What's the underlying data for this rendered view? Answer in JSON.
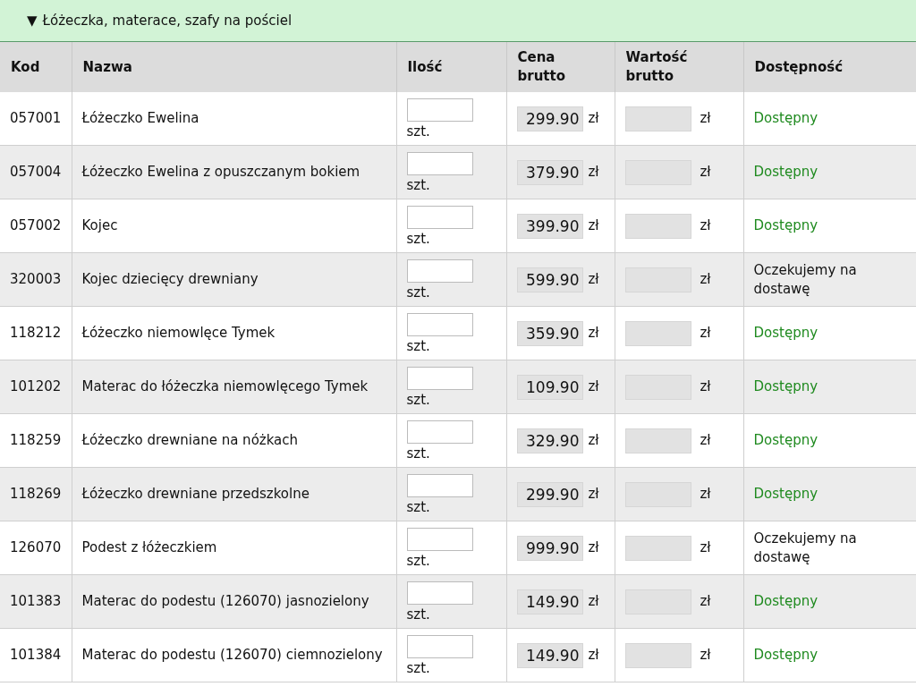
{
  "section": {
    "toggle": "▼",
    "title": "Łóżeczka, materace, szafy na pościel"
  },
  "table": {
    "columns": [
      "Kod",
      "Nazwa",
      "Ilość",
      "Cena brutto",
      "Wartość brutto",
      "Dostępność"
    ],
    "rows": [
      {
        "code": "057001",
        "name": "Łóżeczko Ewelina",
        "unit": "szt.",
        "price": "299.90",
        "currency": "zł",
        "value_currency": "zł",
        "availability": {
          "kind": "available",
          "text": "Dostępny"
        }
      },
      {
        "code": "057004",
        "name": "Łóżeczko Ewelina z opuszczanym bokiem",
        "unit": "szt.",
        "price": "379.90",
        "currency": "zł",
        "value_currency": "zł",
        "availability": {
          "kind": "available",
          "text": "Dostępny"
        }
      },
      {
        "code": "057002",
        "name": "Kojec",
        "unit": "szt.",
        "price": "399.90",
        "currency": "zł",
        "value_currency": "zł",
        "availability": {
          "kind": "available",
          "text": "Dostępny"
        }
      },
      {
        "code": "320003",
        "name": "Kojec dziecięcy drewniany",
        "unit": "szt.",
        "price": "599.90",
        "currency": "zł",
        "value_currency": "zł",
        "availability": {
          "kind": "awaiting",
          "text": "Oczekujemy na dostawę"
        }
      },
      {
        "code": "118212",
        "name": "Łóżeczko niemowlęce Tymek",
        "unit": "szt.",
        "price": "359.90",
        "currency": "zł",
        "value_currency": "zł",
        "availability": {
          "kind": "available",
          "text": "Dostępny"
        }
      },
      {
        "code": "101202",
        "name": "Materac do łóżeczka niemowlęcego Tymek",
        "unit": "szt.",
        "price": "109.90",
        "currency": "zł",
        "value_currency": "zł",
        "availability": {
          "kind": "available",
          "text": "Dostępny"
        }
      },
      {
        "code": "118259",
        "name": "Łóżeczko drewniane na nóżkach",
        "unit": "szt.",
        "price": "329.90",
        "currency": "zł",
        "value_currency": "zł",
        "availability": {
          "kind": "available",
          "text": "Dostępny"
        }
      },
      {
        "code": "118269",
        "name": "Łóżeczko drewniane przedszkolne",
        "unit": "szt.",
        "price": "299.90",
        "currency": "zł",
        "value_currency": "zł",
        "availability": {
          "kind": "available",
          "text": "Dostępny"
        }
      },
      {
        "code": "126070",
        "name": "Podest z łóżeczkiem",
        "unit": "szt.",
        "price": "999.90",
        "currency": "zł",
        "value_currency": "zł",
        "availability": {
          "kind": "awaiting",
          "text": "Oczekujemy na dostawę"
        }
      },
      {
        "code": "101383",
        "name": "Materac do podestu (126070) jasnozielony",
        "unit": "szt.",
        "price": "149.90",
        "currency": "zł",
        "value_currency": "zł",
        "availability": {
          "kind": "available",
          "text": "Dostępny"
        }
      },
      {
        "code": "101384",
        "name": "Materac do podestu (126070) ciemnozielony",
        "unit": "szt.",
        "price": "149.90",
        "currency": "zł",
        "value_currency": "zł",
        "availability": {
          "kind": "available",
          "text": "Dostępny"
        }
      }
    ]
  }
}
